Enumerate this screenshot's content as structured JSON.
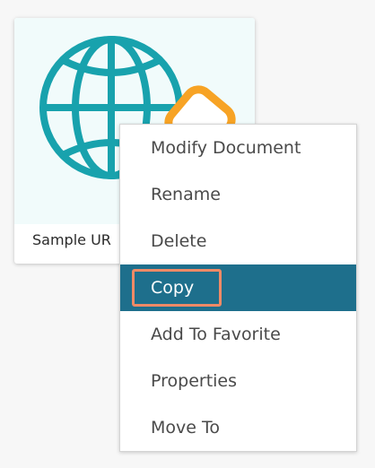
{
  "document": {
    "name": "Sample UR",
    "icon": "globe-icon",
    "badge_icon": "link-icon",
    "colors": {
      "globe": "#18a2ad",
      "badge": "#f7a325",
      "thumbnail_bg": "#f1fbfb"
    }
  },
  "context_menu": {
    "items": [
      {
        "label": "Modify Document",
        "active": false
      },
      {
        "label": "Rename",
        "active": false
      },
      {
        "label": "Delete",
        "active": false
      },
      {
        "label": "Copy",
        "active": true
      },
      {
        "label": "Add To Favorite",
        "active": false
      },
      {
        "label": "Properties",
        "active": false
      },
      {
        "label": "Move To",
        "active": false
      }
    ],
    "colors": {
      "active_bg": "#1e6f8c",
      "highlight": "#ef8a66",
      "text": "#4a4a4a"
    }
  }
}
